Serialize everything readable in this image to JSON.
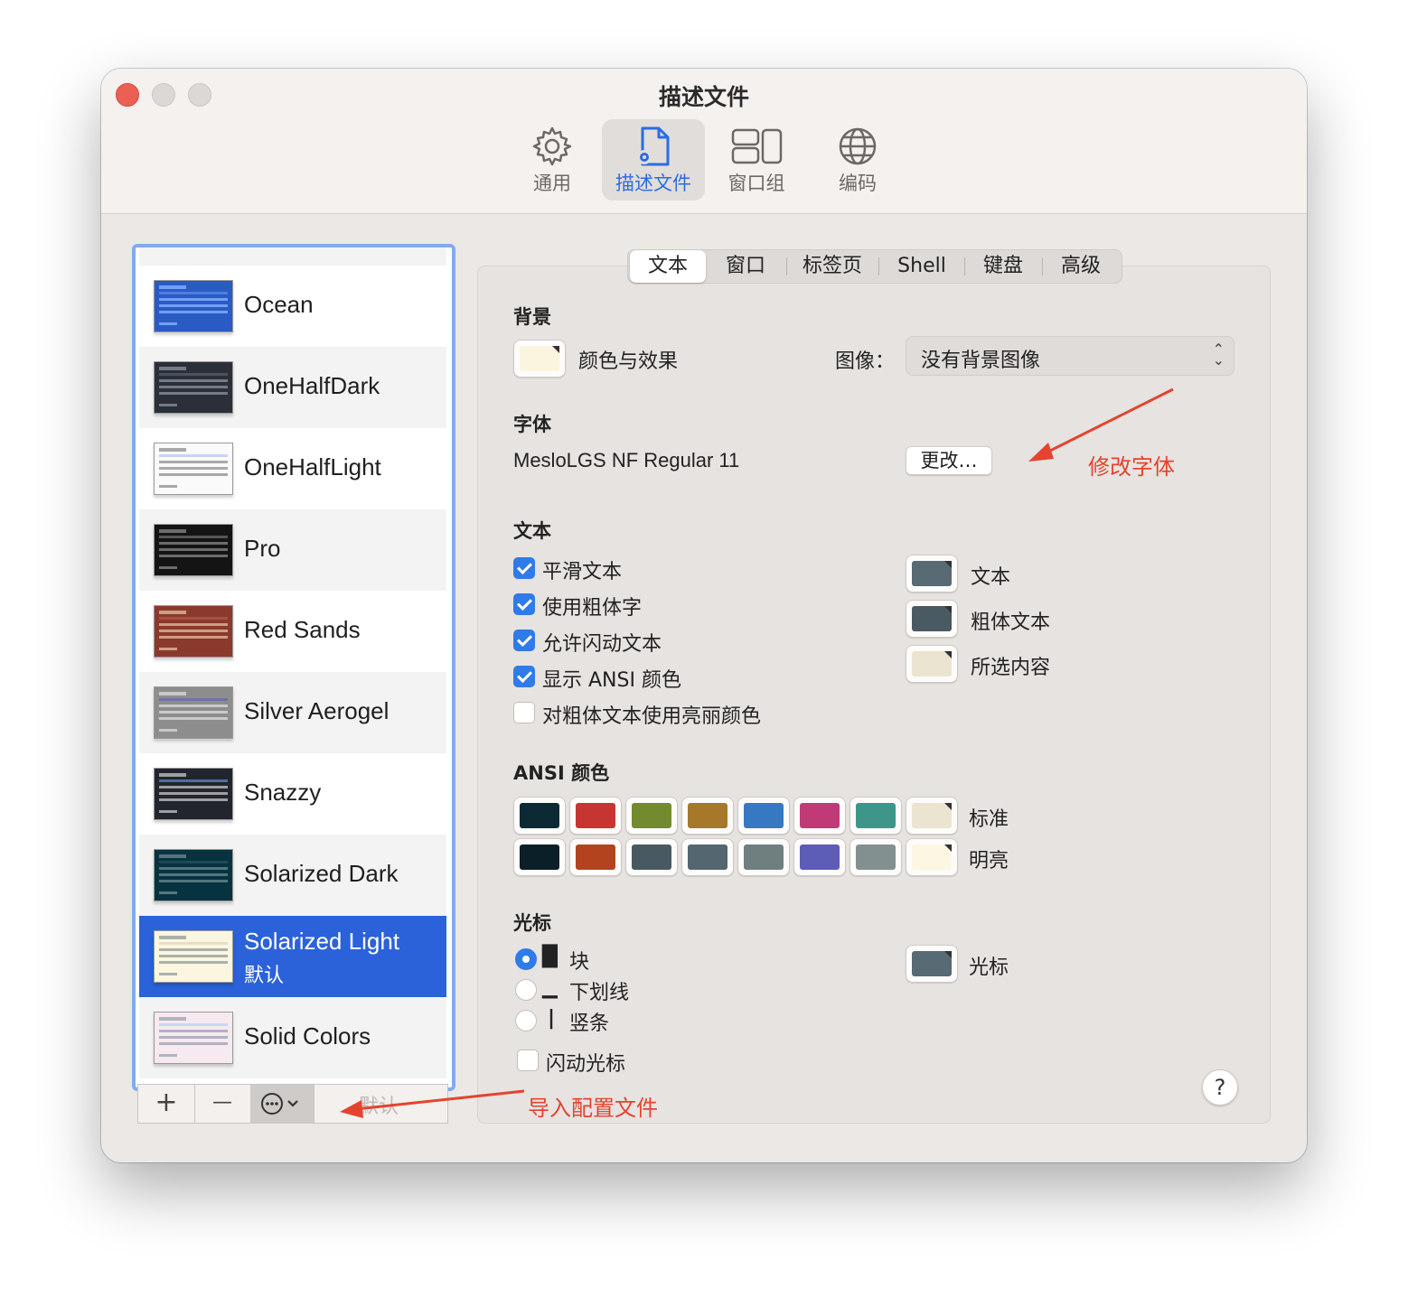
{
  "window": {
    "title": "描述文件"
  },
  "toolbar": {
    "items": [
      {
        "label": "通用",
        "icon": "gear-icon"
      },
      {
        "label": "描述文件",
        "icon": "profile-document-icon"
      },
      {
        "label": "窗口组",
        "icon": "window-groups-icon"
      },
      {
        "label": "编码",
        "icon": "globe-icon"
      }
    ],
    "active_index": 1,
    "accent_color": "#2c6ce0"
  },
  "profiles": {
    "items": [
      {
        "name": "Ocean",
        "thumb_bg": "#2a5bc4",
        "thumb_fg": "#8fb6ff",
        "thumb_hl": "#4f7ee0"
      },
      {
        "name": "OneHalfDark",
        "thumb_bg": "#2b2f38",
        "thumb_fg": "#8e95a3",
        "thumb_hl": "#4b5260"
      },
      {
        "name": "OneHalfLight",
        "thumb_bg": "#fafafa",
        "thumb_fg": "#8c8c8c",
        "thumb_hl": "#c6d3f5"
      },
      {
        "name": "Pro",
        "thumb_bg": "#141414",
        "thumb_fg": "#8a8a8a",
        "thumb_hl": "#555555"
      },
      {
        "name": "Red Sands",
        "thumb_bg": "#8a3a2c",
        "thumb_fg": "#e5c0a0",
        "thumb_hl": "#a65040"
      },
      {
        "name": "Silver Aerogel",
        "thumb_bg": "#8d8d8d",
        "thumb_fg": "#dedede",
        "thumb_hl": "#6d74a8"
      },
      {
        "name": "Snazzy",
        "thumb_bg": "#23252e",
        "thumb_fg": "#c8c8c8",
        "thumb_hl": "#4f6f96"
      },
      {
        "name": "Solarized Dark",
        "thumb_bg": "#06333f",
        "thumb_fg": "#6e8e96",
        "thumb_hl": "#1c4a55"
      },
      {
        "name": "Solarized Light",
        "sub": "默认",
        "thumb_bg": "#fcf5e0",
        "thumb_fg": "#8f9a9a",
        "thumb_hl": "#e7dfc5"
      },
      {
        "name": "Solid Colors",
        "thumb_bg": "#f6e9ef",
        "thumb_fg": "#9aa0b0",
        "thumb_hl": "#c9d7f3"
      }
    ],
    "selected_index": 8,
    "bottom_bar": {
      "add": "+",
      "remove": "—",
      "more": "⋯⌄",
      "default": "默认"
    }
  },
  "tabs": {
    "items": [
      "文本",
      "窗口",
      "标签页",
      "Shell",
      "键盘",
      "高级"
    ],
    "active_index": 0
  },
  "background": {
    "section": "背景",
    "color_label": "颜色与效果",
    "color": "#fbf5e0",
    "image_label": "图像：",
    "image_value": "没有背景图像"
  },
  "font": {
    "section": "字体",
    "value": "MesloLGS NF Regular 11",
    "change_button": "更改…"
  },
  "text": {
    "section": "文本",
    "options": [
      {
        "label": "平滑文本",
        "checked": true
      },
      {
        "label": "使用粗体字",
        "checked": true
      },
      {
        "label": "允许闪动文本",
        "checked": true
      },
      {
        "label": "显示 ANSI 颜色",
        "checked": true
      },
      {
        "label": "对粗体文本使用亮丽颜色",
        "checked": false
      }
    ],
    "colors": [
      {
        "label": "文本",
        "color": "#586a73"
      },
      {
        "label": "粗体文本",
        "color": "#4a5a63"
      },
      {
        "label": "所选内容",
        "color": "#ebe4d0"
      }
    ]
  },
  "ansi": {
    "section": "ANSI 颜色",
    "rows": [
      {
        "label": "标准",
        "colors": [
          "#0c2a34",
          "#c63532",
          "#738a2e",
          "#a6782a",
          "#3778c2",
          "#c13a78",
          "#3e968b",
          "#ebe4d0"
        ]
      },
      {
        "label": "明亮",
        "colors": [
          "#0a1f27",
          "#b3431f",
          "#495961",
          "#546670",
          "#6f7f80",
          "#5d5cb7",
          "#82918f",
          "#fdf6e2"
        ]
      }
    ]
  },
  "cursor": {
    "section": "光标",
    "styles": [
      {
        "glyph": "█",
        "label": "块",
        "selected": true
      },
      {
        "glyph": "▁",
        "label": "下划线",
        "selected": false
      },
      {
        "glyph": "|",
        "label": "竖条",
        "selected": false
      }
    ],
    "blink_label": "闪动光标",
    "blink_checked": false,
    "color_label": "光标",
    "color": "#586a73"
  },
  "help": "?",
  "annotations": {
    "change_font": "修改字体",
    "import_profile": "导入配置文件",
    "color": "#e5432f"
  }
}
